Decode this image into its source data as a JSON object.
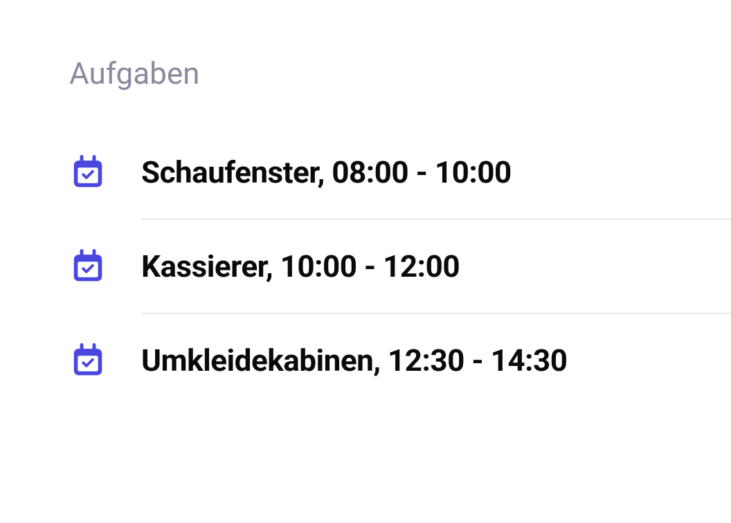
{
  "section": {
    "title": "Aufgaben"
  },
  "tasks": [
    {
      "label": "Schaufenster, 08:00 - 10:00"
    },
    {
      "label": "Kassierer, 10:00 - 12:00"
    },
    {
      "label": "Umkleidekabinen, 12:30 - 14:30"
    }
  ],
  "icon_color": "#4a47e0"
}
